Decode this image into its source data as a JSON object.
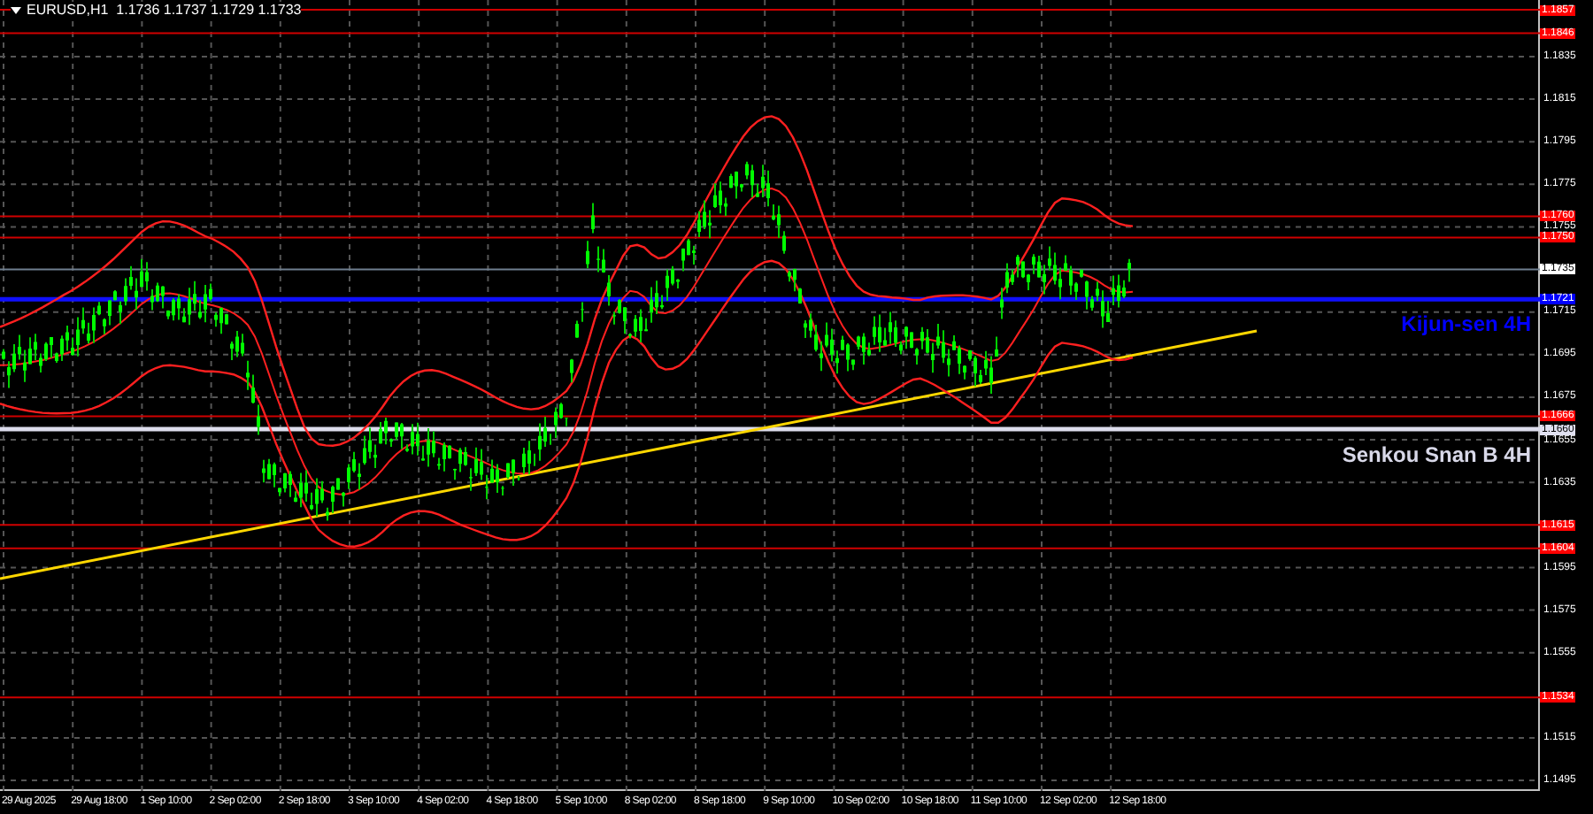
{
  "header": {
    "title": "EURUSD,H1  1.1736 1.1737 1.1729 1.1733"
  },
  "levels": [
    {
      "price": "1.1857",
      "kind": "resistance"
    },
    {
      "price": "1.1846",
      "kind": "resistance"
    },
    {
      "price": "1.1760",
      "kind": "resistance"
    },
    {
      "price": "1.1750",
      "kind": "resistance"
    },
    {
      "price": "1.1735",
      "kind": "current"
    },
    {
      "price": "1.1721",
      "kind": "kijun",
      "caption": "Kijun-sen 4H"
    },
    {
      "price": "1.1666",
      "kind": "resistance"
    },
    {
      "price": "1.1660",
      "kind": "senkou",
      "caption": "Senkou Snan B 4H"
    },
    {
      "price": "1.1615",
      "kind": "resistance"
    },
    {
      "price": "1.1604",
      "kind": "resistance"
    },
    {
      "price": "1.1534",
      "kind": "resistance"
    }
  ],
  "price_ticks": [
    "1.1835",
    "1.1815",
    "1.1795",
    "1.1775",
    "1.1755",
    "1.1715",
    "1.1695",
    "1.1675",
    "1.1655",
    "1.1635",
    "1.1595",
    "1.1575",
    "1.1555",
    "1.1515",
    "1.1495"
  ],
  "time_labels": [
    "29 Aug 2025",
    "29 Aug 18:00",
    "1 Sep 10:00",
    "2 Sep 02:00",
    "2 Sep 18:00",
    "3 Sep 10:00",
    "4 Sep 02:00",
    "4 Sep 18:00",
    "5 Sep 10:00",
    "8 Sep 02:00",
    "8 Sep 18:00",
    "9 Sep 10:00",
    "10 Sep 02:00",
    "10 Sep 18:00",
    "11 Sep 10:00",
    "12 Sep 02:00",
    "12 Sep 18:00"
  ]
}
